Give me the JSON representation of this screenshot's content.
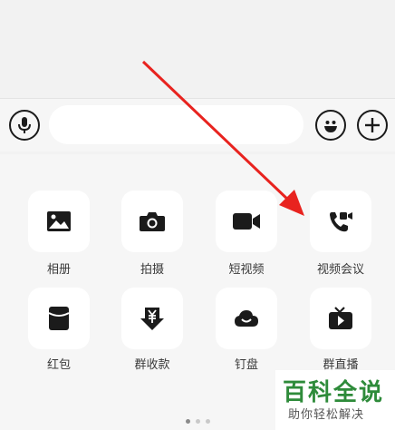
{
  "input_bar": {
    "voice_icon": "microphone-icon",
    "emoji_icon": "smile-face-icon",
    "more_icon": "plus-circle-icon",
    "text_value": ""
  },
  "panel": {
    "tiles": [
      {
        "label": "相册",
        "icon": "photo-album-icon"
      },
      {
        "label": "拍摄",
        "icon": "camera-icon"
      },
      {
        "label": "短视频",
        "icon": "video-camera-icon"
      },
      {
        "label": "视频会议",
        "icon": "video-call-icon"
      },
      {
        "label": "红包",
        "icon": "red-packet-icon"
      },
      {
        "label": "群收款",
        "icon": "group-collect-icon"
      },
      {
        "label": "钉盘",
        "icon": "cloud-drive-icon"
      },
      {
        "label": "群直播",
        "icon": "live-tv-icon"
      }
    ],
    "page_indicator": {
      "pages": 3,
      "current": 1
    }
  },
  "watermark": {
    "main": "百科全说",
    "sub": "助你轻松解决"
  },
  "colors": {
    "background": "#f2f2f2",
    "icon": "#1b1b1b",
    "arrow": "#e8231f",
    "watermark_green": "#2e8b3a"
  }
}
